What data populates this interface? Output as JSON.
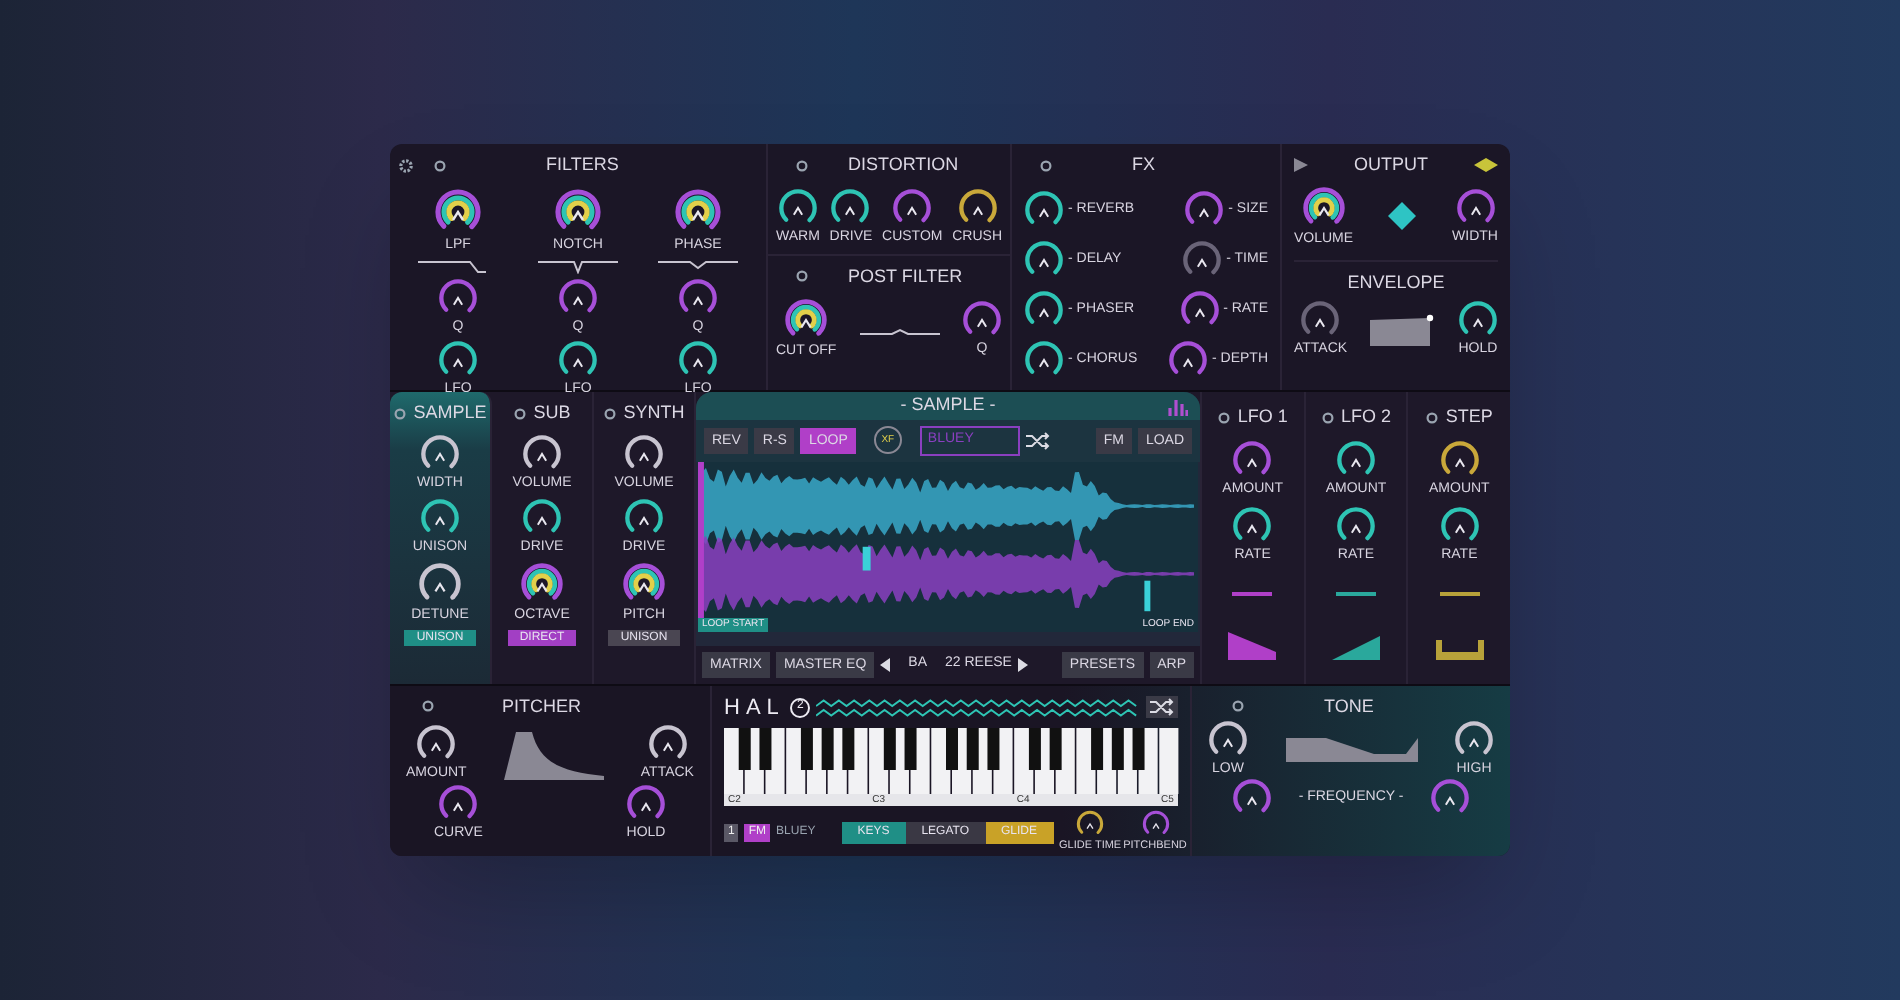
{
  "filters": {
    "title": "FILTERS",
    "columns": [
      {
        "knobs": [
          {
            "label": "LPF",
            "kind": "multi",
            "color": "#a64fd8"
          },
          {
            "label": "Q",
            "kind": "plain",
            "color": "#a64fd8"
          },
          {
            "label": "LFO",
            "kind": "plain",
            "color": "#2ec4b4"
          }
        ]
      },
      {
        "knobs": [
          {
            "label": "NOTCH",
            "kind": "multi",
            "color": "#a64fd8"
          },
          {
            "label": "Q",
            "kind": "plain",
            "color": "#a64fd8"
          },
          {
            "label": "LFO",
            "kind": "plain",
            "color": "#2ec4b4"
          }
        ]
      },
      {
        "knobs": [
          {
            "label": "PHASE",
            "kind": "multi",
            "color": "#a64fd8"
          },
          {
            "label": "Q",
            "kind": "plain",
            "color": "#a64fd8"
          },
          {
            "label": "LFO",
            "kind": "plain",
            "color": "#2ec4b4"
          }
        ]
      }
    ]
  },
  "distortion": {
    "title": "DISTORTION",
    "knobs": [
      {
        "label": "WARM",
        "kind": "plain",
        "color": "#2ec4b4"
      },
      {
        "label": "DRIVE",
        "kind": "plain",
        "color": "#2ec4b4"
      },
      {
        "label": "CUSTOM",
        "kind": "plain",
        "color": "#a64fd8"
      },
      {
        "label": "CRUSH",
        "kind": "plain",
        "color": "#c9a83a"
      }
    ]
  },
  "post_filter": {
    "title": "POST FILTER",
    "knobs": [
      {
        "label": "CUT OFF",
        "kind": "multi",
        "color": "#a64fd8"
      },
      {
        "label": "Q",
        "kind": "plain",
        "color": "#a64fd8"
      }
    ]
  },
  "fx": {
    "title": "FX",
    "rows": [
      {
        "left": {
          "label": "- REVERB",
          "kind": "plain",
          "color": "#2ec4b4"
        },
        "right": {
          "label": "- SIZE",
          "kind": "plain",
          "color": "#a64fd8"
        }
      },
      {
        "left": {
          "label": "- DELAY",
          "kind": "plain",
          "color": "#2ec4b4"
        },
        "right": {
          "label": "- TIME",
          "kind": "plain",
          "color": "#6a6478"
        }
      },
      {
        "left": {
          "label": "- PHASER",
          "kind": "plain",
          "color": "#2ec4b4"
        },
        "right": {
          "label": "- RATE",
          "kind": "plain",
          "color": "#a64fd8"
        }
      },
      {
        "left": {
          "label": "- CHORUS",
          "kind": "plain",
          "color": "#2ec4b4"
        },
        "right": {
          "label": "- DEPTH",
          "kind": "plain",
          "color": "#a64fd8"
        }
      }
    ]
  },
  "output": {
    "title": "OUTPUT",
    "knobs": [
      {
        "label": "VOLUME",
        "kind": "multi",
        "color": "#a64fd8"
      },
      {
        "label": "WIDTH",
        "kind": "plain",
        "color": "#a64fd8"
      }
    ]
  },
  "envelope": {
    "title": "ENVELOPE",
    "knobs": [
      {
        "label": "ATTACK",
        "kind": "plain",
        "color": "#6a6478"
      },
      {
        "label": "HOLD",
        "kind": "plain",
        "color": "#2ec4b4"
      }
    ]
  },
  "sources": [
    {
      "title": "SAMPLE",
      "selected": true,
      "knobs": [
        {
          "label": "WIDTH",
          "kind": "plain",
          "color": "#c8c4d0"
        },
        {
          "label": "UNISON",
          "kind": "plain",
          "color": "#2ec4b4"
        },
        {
          "label": "DETUNE",
          "kind": "plain",
          "color": "#c8c4d0"
        }
      ],
      "tag": {
        "label": "UNISON",
        "color": "#1f8f86"
      }
    },
    {
      "title": "SUB",
      "selected": false,
      "knobs": [
        {
          "label": "VOLUME",
          "kind": "plain",
          "color": "#c8c4d0"
        },
        {
          "label": "DRIVE",
          "kind": "plain",
          "color": "#2ec4b4"
        },
        {
          "label": "OCTAVE",
          "kind": "multi",
          "color": "#a64fd8"
        }
      ],
      "tag": {
        "label": "DIRECT",
        "color": "#a23fc4"
      }
    },
    {
      "title": "SYNTH",
      "selected": false,
      "knobs": [
        {
          "label": "VOLUME",
          "kind": "plain",
          "color": "#c8c4d0"
        },
        {
          "label": "DRIVE",
          "kind": "plain",
          "color": "#2ec4b4"
        },
        {
          "label": "PITCH",
          "kind": "multi",
          "color": "#a64fd8"
        }
      ],
      "tag": {
        "label": "UNISON",
        "color": "#4a4652"
      }
    }
  ],
  "sample_editor": {
    "title": "- SAMPLE -",
    "buttons": [
      {
        "label": "REV",
        "selected": false
      },
      {
        "label": "R-S",
        "selected": false
      },
      {
        "label": "LOOP",
        "selected": true
      }
    ],
    "xf": "XF",
    "dropdown": "BLUEY",
    "right_buttons": [
      "FM",
      "LOAD"
    ],
    "loop_start": "LOOP START",
    "loop_end": "LOOP END"
  },
  "footer": {
    "left_buttons": [
      "MATRIX",
      "MASTER EQ"
    ],
    "preset_bank": "BA",
    "preset_name": "22 REESE",
    "right_buttons": [
      "PRESETS",
      "ARP"
    ]
  },
  "modulators": [
    {
      "title": "LFO 1",
      "color": "#b03fc8",
      "kind": "down",
      "knobs": [
        {
          "label": "AMOUNT",
          "kind": "plain",
          "color": "#a64fd8"
        },
        {
          "label": "RATE",
          "kind": "plain",
          "color": "#2ec4b4"
        }
      ]
    },
    {
      "title": "LFO 2",
      "color": "#2aa89c",
      "kind": "up",
      "knobs": [
        {
          "label": "AMOUNT",
          "kind": "plain",
          "color": "#2ec4b4"
        },
        {
          "label": "RATE",
          "kind": "plain",
          "color": "#2ec4b4"
        }
      ]
    },
    {
      "title": "STEP",
      "color": "#b8a23a",
      "kind": "steps",
      "knobs": [
        {
          "label": "AMOUNT",
          "kind": "plain",
          "color": "#c9a83a"
        },
        {
          "label": "RATE",
          "kind": "plain",
          "color": "#2ec4b4"
        }
      ]
    }
  ],
  "pitcher": {
    "title": "PITCHER",
    "knobs": [
      {
        "label": "AMOUNT",
        "kind": "plain",
        "color": "#c8c4d0"
      },
      {
        "label": "ATTACK",
        "kind": "plain",
        "color": "#c8c4d0"
      },
      {
        "label": "CURVE",
        "kind": "plain",
        "color": "#a64fd8"
      },
      {
        "label": "HOLD",
        "kind": "plain",
        "color": "#a64fd8"
      }
    ]
  },
  "keyboard": {
    "logo": "HAL",
    "logo_badge": "2",
    "octave_labels": [
      "C2",
      "C3",
      "C4",
      "C5"
    ],
    "channel": "1",
    "fm": "FM",
    "preset": "BLUEY",
    "modes": [
      {
        "label": "KEYS",
        "color": "#1f8f86"
      },
      {
        "label": "LEGATO",
        "color": "#3a3844"
      },
      {
        "label": "GLIDE",
        "color": "#c9a227"
      }
    ],
    "knobs": [
      {
        "label": "GLIDE TIME",
        "kind": "plain",
        "color": "#c9a83a"
      },
      {
        "label": "PITCHBEND",
        "kind": "plain",
        "color": "#a64fd8"
      }
    ]
  },
  "tone": {
    "title": "TONE",
    "knobs": [
      {
        "label": "LOW",
        "kind": "plain",
        "color": "#c8c4d0"
      },
      {
        "label": "HIGH",
        "kind": "plain",
        "color": "#c8c4d0"
      }
    ],
    "frequency_label": "- FREQUENCY -",
    "frequency_knobs": [
      {
        "kind": "plain",
        "color": "#a64fd8"
      },
      {
        "kind": "plain",
        "color": "#a64fd8"
      }
    ]
  }
}
